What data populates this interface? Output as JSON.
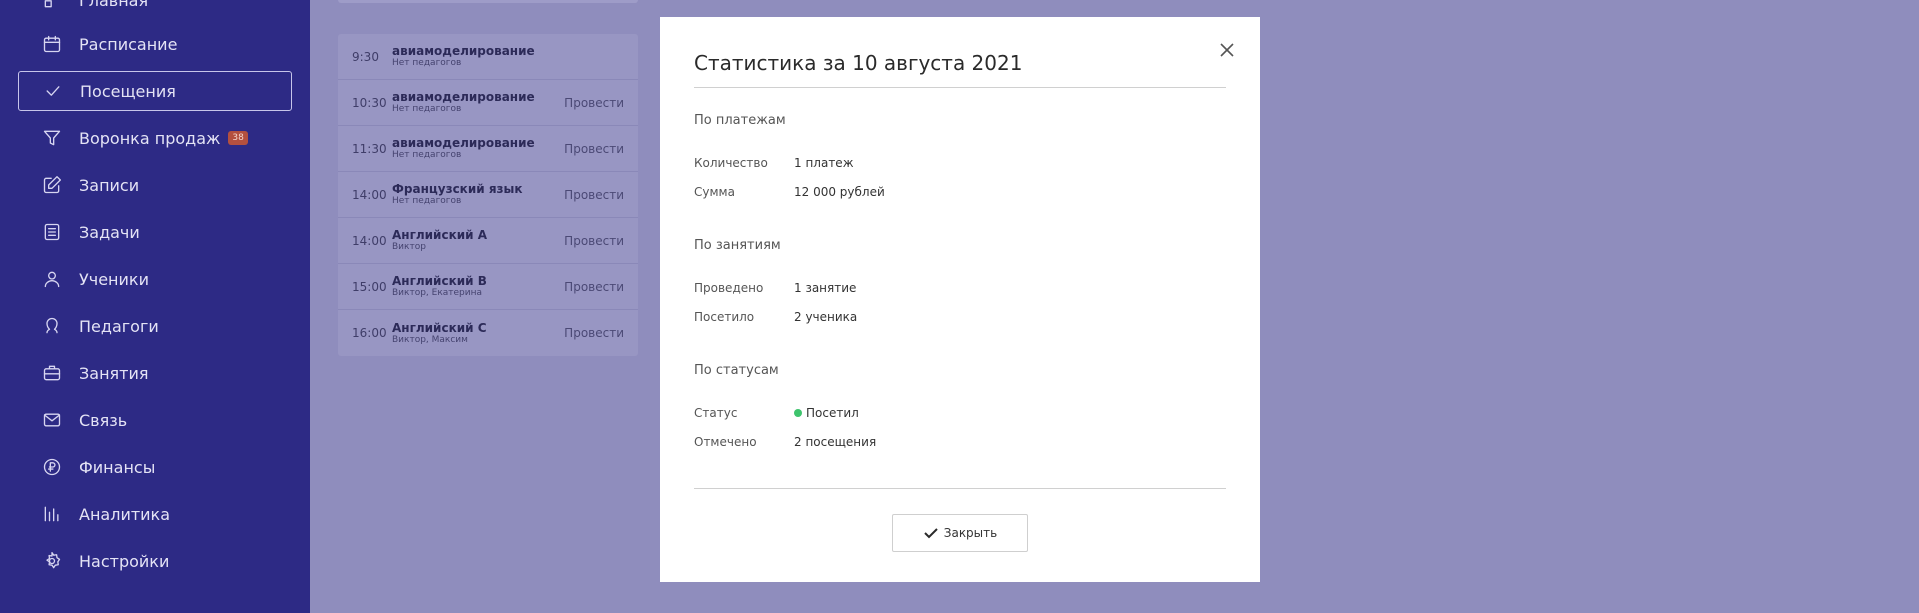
{
  "sidebar": {
    "items": [
      {
        "label": "Главная",
        "icon": "home-icon"
      },
      {
        "label": "Расписание",
        "icon": "calendar-icon"
      },
      {
        "label": "Посещения",
        "icon": "check-icon",
        "active": true
      },
      {
        "label": "Воронка продаж",
        "icon": "filter-icon",
        "badge": "38"
      },
      {
        "label": "Записи",
        "icon": "edit-icon"
      },
      {
        "label": "Задачи",
        "icon": "tasks-icon"
      },
      {
        "label": "Ученики",
        "icon": "user-icon"
      },
      {
        "label": "Педагоги",
        "icon": "teacher-icon"
      },
      {
        "label": "Занятия",
        "icon": "briefcase-icon"
      },
      {
        "label": "Связь",
        "icon": "mail-icon"
      },
      {
        "label": "Финансы",
        "icon": "ruble-icon"
      },
      {
        "label": "Аналитика",
        "icon": "chart-icon"
      },
      {
        "label": "Настройки",
        "icon": "gear-icon"
      }
    ]
  },
  "lessons": [
    {
      "time": "9:30",
      "title": "авиамоделирование",
      "sub": "Нет педагогов",
      "action": ""
    },
    {
      "time": "10:30",
      "title": "авиамоделирование",
      "sub": "Нет педагогов",
      "action": "Провести"
    },
    {
      "time": "11:30",
      "title": "авиамоделирование",
      "sub": "Нет педагогов",
      "action": "Провести"
    },
    {
      "time": "14:00",
      "title": "Французский язык",
      "sub": "Нет педагогов",
      "action": "Провести"
    },
    {
      "time": "14:00",
      "title": "Английский А",
      "sub": "Виктор",
      "action": "Провести"
    },
    {
      "time": "15:00",
      "title": "Английский В",
      "sub": "Виктор, Екатерина",
      "action": "Провести"
    },
    {
      "time": "16:00",
      "title": "Английский С",
      "sub": "Виктор, Максим",
      "action": "Провести"
    }
  ],
  "modal": {
    "title": "Статистика за 10 августа 2021",
    "payments": {
      "heading": "По платежам",
      "count_label": "Количество",
      "count_value": "1 платеж",
      "sum_label": "Сумма",
      "sum_value": "12 000 рублей"
    },
    "classes": {
      "heading": "По занятиям",
      "held_label": "Проведено",
      "held_value": "1 занятие",
      "attended_label": "Посетило",
      "attended_value": "2 ученика"
    },
    "statuses": {
      "heading": "По статусам",
      "status_label": "Статус",
      "status_value": "Посетил",
      "status_color": "#3ec46d",
      "marked_label": "Отмечено",
      "marked_value": "2 посещения"
    },
    "close_label": "Закрыть"
  }
}
